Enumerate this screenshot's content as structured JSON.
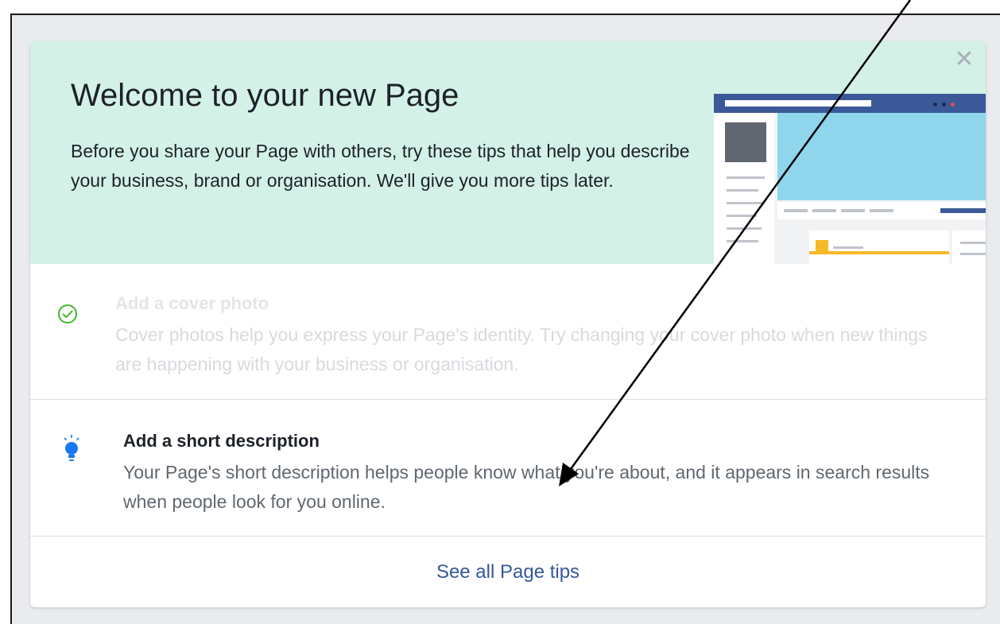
{
  "header": {
    "title": "Welcome to your new Page",
    "intro": "Before you share your Page with others, try these tips that help you describe your business, brand or organisation. We'll give you more tips later."
  },
  "close": {
    "icon": "close-icon",
    "glyph": "✕"
  },
  "tips": [
    {
      "title": "Add a cover photo",
      "description": "Cover photos help you express your Page's identity. Try changing your cover photo when new things are happening with your business or organisation.",
      "status": "completed",
      "icon": "check-circle-icon"
    },
    {
      "title": "Add a short description",
      "description": "Your Page's short description helps people know what you're about, and it appears in search results when people look for you online.",
      "status": "pending",
      "icon": "lightbulb-icon"
    }
  ],
  "footer": {
    "see_all": "See all Page tips"
  },
  "colors": {
    "header_bg": "#d4f1e7",
    "link": "#365899",
    "check": "#42b72a",
    "bulb": "#1877f2",
    "fb_blue": "#3b5998"
  }
}
